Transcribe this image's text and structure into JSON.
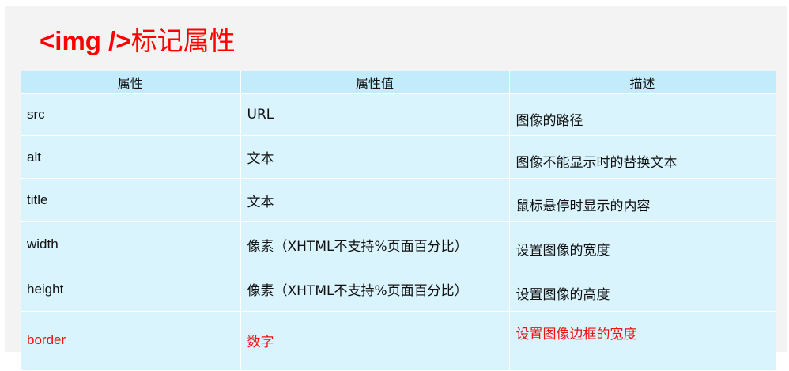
{
  "title": {
    "tag": "<img />",
    "rest": "标记属性"
  },
  "table": {
    "headers": [
      "属性",
      "属性值",
      "描述"
    ],
    "rows": [
      {
        "name": "src",
        "value": "URL",
        "desc": "图像的路径",
        "highlight": false
      },
      {
        "name": "alt",
        "value": "文本",
        "desc": "图像不能显示时的替换文本",
        "highlight": false
      },
      {
        "name": "title",
        "value": "文本",
        "desc": "鼠标悬停时显示的内容",
        "highlight": false
      },
      {
        "name": "width",
        "value": "像素（XHTML不支持%页面百分比）",
        "desc": "设置图像的宽度",
        "highlight": false
      },
      {
        "name": "height",
        "value": "像素（XHTML不支持%页面百分比）",
        "desc": "设置图像的高度",
        "highlight": false
      },
      {
        "name": "border",
        "value": "数字",
        "desc": "设置图像边框的宽度",
        "highlight": true
      }
    ]
  },
  "colors": {
    "title": "#ff0000",
    "highlight_text": "#ee1111",
    "header_bg": "#c2ecfb",
    "row_bg": "#d9f4fd",
    "slide_bg": "#f3f3f3"
  }
}
